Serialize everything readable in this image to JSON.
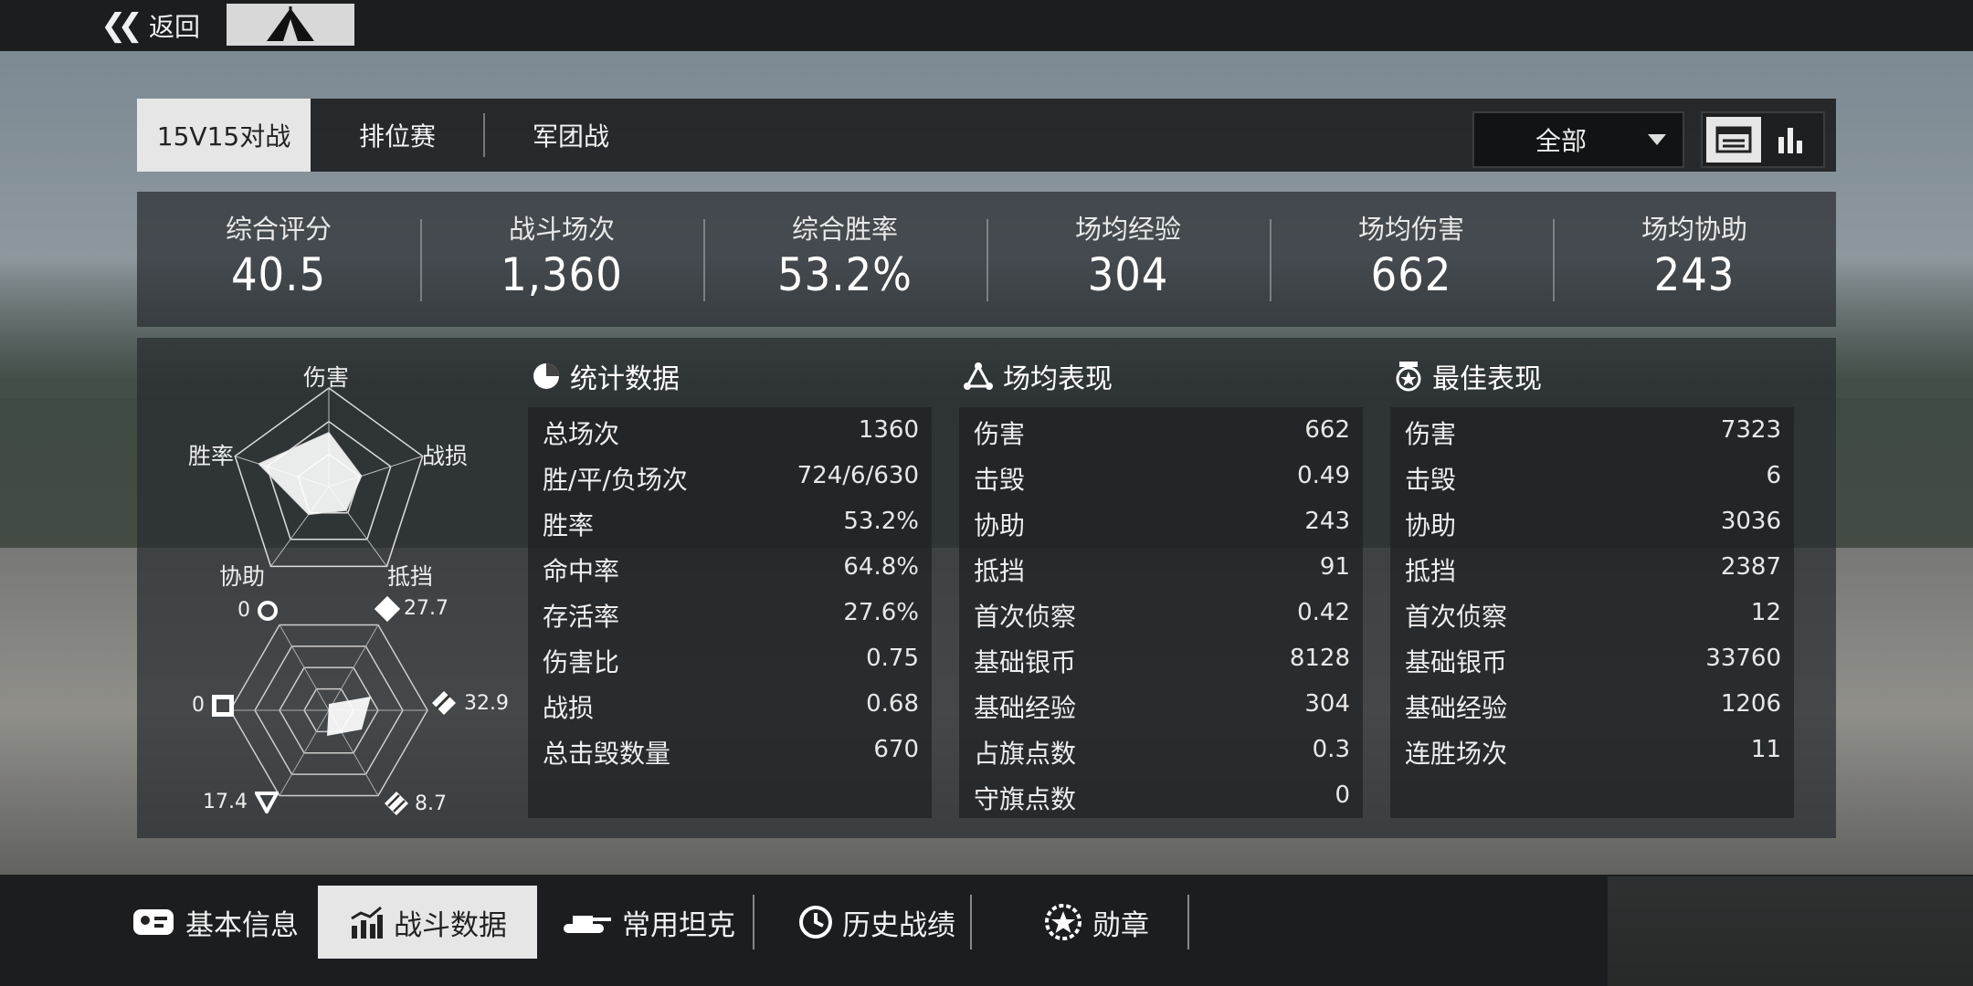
{
  "topbar": {
    "back_label": "返回"
  },
  "battle_tabs": [
    {
      "label": "15V15对战",
      "active": true
    },
    {
      "label": "排位赛",
      "active": false
    },
    {
      "label": "军团战",
      "active": false
    }
  ],
  "filter": {
    "selected": "全部"
  },
  "summary": [
    {
      "label": "综合评分",
      "value": "40.5"
    },
    {
      "label": "战斗场次",
      "value": "1,360"
    },
    {
      "label": "综合胜率",
      "value": "53.2%"
    },
    {
      "label": "场均经验",
      "value": "304"
    },
    {
      "label": "场均伤害",
      "value": "662"
    },
    {
      "label": "场均协助",
      "value": "243"
    }
  ],
  "radar_top": {
    "labels": {
      "top": "伤害",
      "left": "胜率",
      "right": "战损",
      "bottom_left": "协助",
      "bottom_right": "抵挡"
    },
    "values": {
      "damage": 0.55,
      "losses": 0.35,
      "block": 0.3,
      "assist": 0.35,
      "winrate": 0.75
    }
  },
  "radar_bottom": {
    "values": {
      "top_left": "0",
      "top_right": "27.7",
      "right": "32.9",
      "bottom_right": "8.7",
      "bottom_left": "17.4",
      "left": "0"
    }
  },
  "sections": {
    "stats": {
      "title": "统计数据",
      "rows": [
        {
          "k": "总场次",
          "v": "1360"
        },
        {
          "k": "胜/平/负场次",
          "v": "724/6/630"
        },
        {
          "k": "胜率",
          "v": "53.2%"
        },
        {
          "k": "命中率",
          "v": "64.8%"
        },
        {
          "k": "存活率",
          "v": "27.6%"
        },
        {
          "k": "伤害比",
          "v": "0.75"
        },
        {
          "k": "战损",
          "v": "0.68"
        },
        {
          "k": "总击毁数量",
          "v": "670"
        }
      ]
    },
    "average": {
      "title": "场均表现",
      "rows": [
        {
          "k": "伤害",
          "v": "662"
        },
        {
          "k": "击毁",
          "v": "0.49"
        },
        {
          "k": "协助",
          "v": "243"
        },
        {
          "k": "抵挡",
          "v": "91"
        },
        {
          "k": "首次侦察",
          "v": "0.42"
        },
        {
          "k": "基础银币",
          "v": "8128"
        },
        {
          "k": "基础经验",
          "v": "304"
        },
        {
          "k": "占旗点数",
          "v": "0.3"
        },
        {
          "k": "守旗点数",
          "v": "0"
        }
      ]
    },
    "best": {
      "title": "最佳表现",
      "rows": [
        {
          "k": "伤害",
          "v": "7323"
        },
        {
          "k": "击毁",
          "v": "6"
        },
        {
          "k": "协助",
          "v": "3036"
        },
        {
          "k": "抵挡",
          "v": "2387"
        },
        {
          "k": "首次侦察",
          "v": "12"
        },
        {
          "k": "基础银币",
          "v": "33760"
        },
        {
          "k": "基础经验",
          "v": "1206"
        },
        {
          "k": "连胜场次",
          "v": "11"
        }
      ]
    }
  },
  "bottom_tabs": [
    {
      "label": "基本信息",
      "icon": "id-card-icon",
      "active": false
    },
    {
      "label": "战斗数据",
      "icon": "bar-chart-icon",
      "active": true
    },
    {
      "label": "常用坦克",
      "icon": "tank-icon",
      "active": false
    },
    {
      "label": "历史战绩",
      "icon": "clock-icon",
      "active": false
    },
    {
      "label": "勋章",
      "icon": "medal-icon",
      "active": false
    }
  ]
}
